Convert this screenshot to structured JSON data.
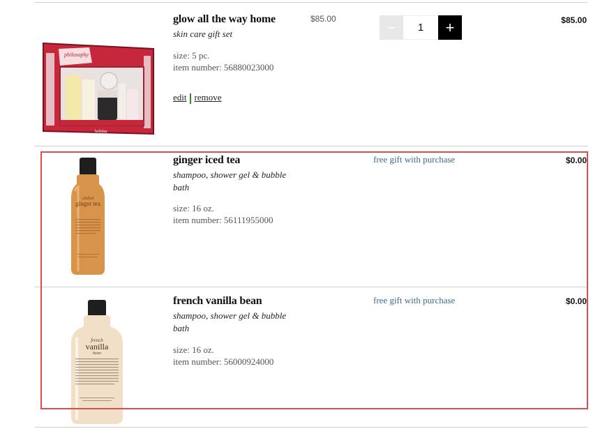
{
  "items": [
    {
      "name": "glow all the way home",
      "subtitle": "skin care gift set",
      "size": "size: 5 pc.",
      "item_number": "item number: 56880023000",
      "unit_price": "$85.00",
      "quantity": "1",
      "total": "$85.00",
      "edit_label": "edit",
      "remove_label": "remove",
      "box_text": "glow all the way home",
      "brand": "philosophy"
    },
    {
      "name": "ginger iced tea",
      "subtitle": "shampoo, shower gel & bubble bath",
      "size": "size: 16 oz.",
      "item_number": "item number: 56111955000",
      "gift_label": "free gift with purchase",
      "total": "$0.00",
      "bottle_text_small": "chilled",
      "bottle_text_big": "ginger tea"
    },
    {
      "name": "french vanilla bean",
      "subtitle": "shampoo, shower gel & bubble bath",
      "size": "size: 16 oz.",
      "item_number": "item number: 56000924000",
      "gift_label": "free gift with purchase",
      "total": "$0.00",
      "bottle_text_small": "french",
      "bottle_text_big": "vanilla",
      "bottle_text_after": "bean"
    }
  ],
  "icons": {
    "minus": "−",
    "plus": "+"
  },
  "colors": {
    "highlight": "#e14b4b",
    "link": "#3d6a8c",
    "ginger": "#d9944c",
    "vanilla": "#f1dfc7"
  }
}
